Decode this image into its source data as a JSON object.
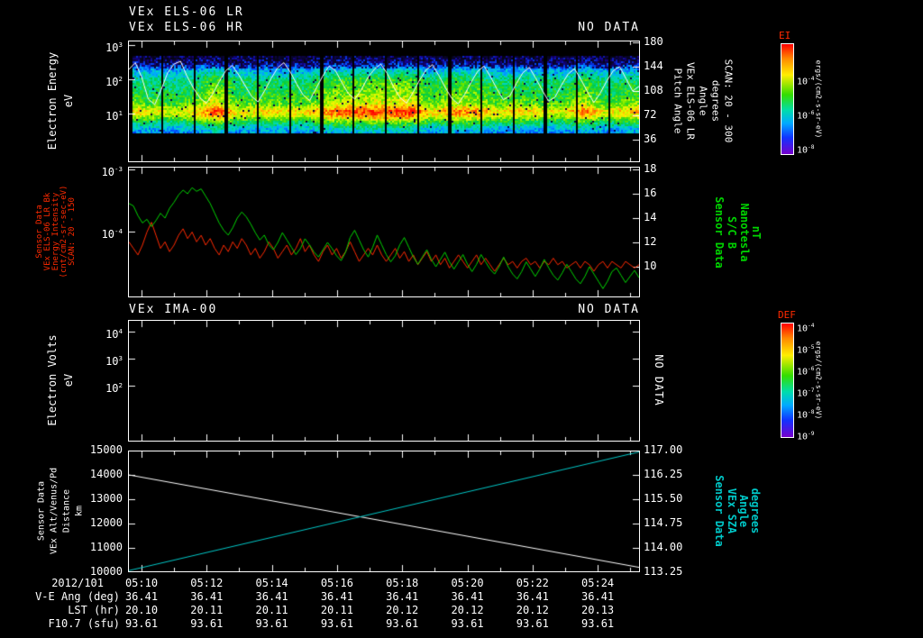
{
  "header": {
    "title_lr": "VEx ELS-06 LR",
    "title_hr": "VEx ELS-06 HR",
    "no_data": "NO DATA"
  },
  "accent_colors": {
    "white": "#ffffff",
    "red": "#ff2a00",
    "green": "#00d400",
    "cyan": "#00c8c8"
  },
  "chart_data": [
    {
      "type": "heatmap",
      "name": "els_spectrogram",
      "title": "VEx ELS-06 HR",
      "left_labels": [
        "Electron Energy",
        "eV"
      ],
      "yticks": [
        {
          "b": "10",
          "e": "3"
        },
        {
          "b": "10",
          "e": "2"
        },
        {
          "b": "10",
          "e": "1"
        }
      ],
      "right_labels": [
        "Pitch Angle",
        "VEx ELS-06 LR",
        "Angle",
        "degrees",
        "SCAN: 20 - 300"
      ],
      "right_ticks": [
        "180",
        "144",
        "108",
        "72",
        "36"
      ],
      "colorscale": "rainbow",
      "pitch_trace": [
        140,
        150,
        128,
        96,
        88,
        110,
        135,
        148,
        152,
        130,
        112,
        98,
        90,
        104,
        122,
        138,
        146,
        132,
        116,
        100,
        92,
        108,
        126,
        142,
        150,
        136,
        118,
        102,
        94,
        112,
        130,
        145,
        138,
        120,
        104,
        96,
        110,
        128,
        140,
        148,
        134,
        114,
        98,
        90,
        106,
        124,
        139,
        147,
        131,
        113,
        97,
        89,
        103,
        121,
        137,
        145,
        129,
        111,
        95,
        101,
        119,
        135,
        143,
        127,
        109,
        93,
        99,
        117,
        133,
        141,
        125,
        107,
        91,
        105,
        123,
        138,
        144,
        126,
        108,
        115
      ]
    },
    {
      "type": "line",
      "name": "intensity_and_bfield",
      "left_labels": [
        "Sensor Data",
        "VEx ELS-06 LR Bk",
        "Energy Intensity",
        "(cnt/cm2-sr-sec-eV)",
        "SCAN: 20 - 150"
      ],
      "left_ticks": [
        {
          "b": "10",
          "e": "-3"
        },
        {
          "b": "10",
          "e": "-4"
        }
      ],
      "left_range_log10": [
        -5,
        -3
      ],
      "right_labels": [
        "Sensor Data",
        "S/C B",
        "Nanotesla",
        "nT"
      ],
      "right_ticks": [
        "18",
        "16",
        "14",
        "12",
        "10"
      ],
      "right_range_nT": [
        7.5,
        18.2
      ],
      "series": [
        {
          "name": "els_bk_intensity_log10",
          "color": "#ff2a00",
          "axis": "left",
          "values": [
            -4.15,
            -4.25,
            -4.35,
            -4.2,
            -4.0,
            -3.85,
            -4.05,
            -4.25,
            -4.15,
            -4.3,
            -4.2,
            -4.05,
            -3.95,
            -4.1,
            -4.0,
            -4.15,
            -4.05,
            -4.2,
            -4.1,
            -4.25,
            -4.35,
            -4.2,
            -4.3,
            -4.15,
            -4.25,
            -4.1,
            -4.2,
            -4.35,
            -4.25,
            -4.4,
            -4.3,
            -4.15,
            -4.25,
            -4.4,
            -4.3,
            -4.2,
            -4.35,
            -4.25,
            -4.1,
            -4.3,
            -4.2,
            -4.35,
            -4.45,
            -4.3,
            -4.2,
            -4.35,
            -4.25,
            -4.4,
            -4.3,
            -4.15,
            -4.3,
            -4.45,
            -4.35,
            -4.25,
            -4.35,
            -4.2,
            -4.35,
            -4.45,
            -4.35,
            -4.25,
            -4.4,
            -4.3,
            -4.45,
            -4.35,
            -4.5,
            -4.4,
            -4.3,
            -4.45,
            -4.35,
            -4.5,
            -4.4,
            -4.55,
            -4.45,
            -4.35,
            -4.45,
            -4.55,
            -4.45,
            -4.35,
            -4.5,
            -4.4,
            -4.5,
            -4.6,
            -4.5,
            -4.4,
            -4.5,
            -4.45,
            -4.55,
            -4.45,
            -4.4,
            -4.5,
            -4.45,
            -4.55,
            -4.45,
            -4.5,
            -4.4,
            -4.5,
            -4.45,
            -4.55,
            -4.5,
            -4.45,
            -4.55,
            -4.45,
            -4.5,
            -4.6,
            -4.5,
            -4.45,
            -4.55,
            -4.45,
            -4.5,
            -4.55,
            -4.45,
            -4.5,
            -4.55,
            -4.5
          ]
        },
        {
          "name": "sc_b_field_nT",
          "color": "#00d400",
          "axis": "right",
          "values": [
            15.2,
            15.0,
            14.2,
            13.6,
            13.9,
            13.3,
            13.8,
            14.4,
            14.0,
            14.8,
            15.3,
            15.9,
            16.3,
            16.0,
            16.5,
            16.2,
            16.4,
            15.8,
            15.2,
            14.4,
            13.6,
            13.0,
            12.6,
            13.2,
            14.0,
            14.5,
            14.1,
            13.5,
            12.8,
            12.2,
            12.6,
            11.8,
            11.4,
            12.0,
            12.8,
            12.2,
            11.6,
            11.0,
            11.5,
            12.3,
            11.8,
            11.2,
            10.8,
            11.4,
            12.0,
            11.5,
            10.9,
            10.5,
            11.2,
            12.4,
            13.0,
            12.2,
            11.4,
            10.8,
            11.6,
            12.6,
            11.8,
            11.0,
            10.4,
            10.9,
            11.8,
            12.4,
            11.6,
            10.8,
            10.2,
            10.8,
            11.4,
            10.6,
            10.0,
            10.6,
            11.2,
            10.4,
            9.8,
            10.4,
            11.0,
            10.2,
            9.6,
            10.2,
            11.0,
            10.4,
            9.8,
            9.4,
            10.0,
            10.8,
            10.0,
            9.4,
            9.0,
            9.6,
            10.4,
            9.8,
            9.2,
            9.8,
            10.6,
            9.9,
            9.3,
            8.9,
            9.5,
            10.2,
            9.6,
            9.0,
            8.6,
            9.2,
            10.0,
            9.4,
            8.8,
            8.2,
            8.8,
            9.6,
            9.9,
            9.3,
            8.7,
            9.2,
            9.7,
            9.1
          ]
        }
      ]
    },
    {
      "type": "empty",
      "name": "ima_panel",
      "title": "VEx IMA-00",
      "no_data": "NO DATA",
      "right_note": "NO DATA",
      "left_labels": [
        "Electron Volts",
        "eV"
      ],
      "yticks": [
        {
          "b": "10",
          "e": "4"
        },
        {
          "b": "10",
          "e": "3"
        },
        {
          "b": "10",
          "e": "2"
        }
      ]
    },
    {
      "type": "line",
      "name": "altitude_and_sza",
      "left_labels": [
        "Sensor Data",
        "VEx Alt/Venus/Pd",
        "Distance",
        "km"
      ],
      "left_ticks": [
        "15000",
        "14000",
        "13000",
        "12000",
        "11000",
        "10000"
      ],
      "left_range_km": [
        10000,
        15000
      ],
      "right_labels": [
        "Sensor Data",
        "VEx SZA",
        "Angle",
        "degrees"
      ],
      "right_ticks": [
        "117.00",
        "116.25",
        "115.50",
        "114.75",
        "114.00",
        "113.25"
      ],
      "right_range_deg": [
        113.25,
        117.0
      ],
      "series": [
        {
          "name": "altitude_km",
          "color": "#ffffff",
          "axis": "left",
          "values": [
            14000,
            10200
          ]
        },
        {
          "name": "sza_deg",
          "color": "#00c8c8",
          "axis": "right",
          "values": [
            113.3,
            117.0
          ]
        }
      ]
    }
  ],
  "colorbars": [
    {
      "label": "EI",
      "unit": "ergs/(cm2-s-sr-eV)",
      "ticks": [
        {
          "b": "10",
          "e": "-4"
        },
        {
          "b": "10",
          "e": "-6"
        },
        {
          "b": "10",
          "e": "-8"
        }
      ]
    },
    {
      "label": "DEF",
      "unit": "ergs/(cm2-s-sr-eV)",
      "ticks": [
        {
          "b": "10",
          "e": "-4"
        },
        {
          "b": "10",
          "e": "-5"
        },
        {
          "b": "10",
          "e": "-6"
        },
        {
          "b": "10",
          "e": "-7"
        },
        {
          "b": "10",
          "e": "-8"
        },
        {
          "b": "10",
          "e": "-9"
        }
      ]
    }
  ],
  "bottom_axis": {
    "date": "2012/101",
    "times": [
      "05:10",
      "05:12",
      "05:14",
      "05:16",
      "05:18",
      "05:20",
      "05:22",
      "05:24"
    ],
    "rows": [
      {
        "label": "V-E Ang (deg)",
        "values": [
          "36.41",
          "36.41",
          "36.41",
          "36.41",
          "36.41",
          "36.41",
          "36.41",
          "36.41"
        ]
      },
      {
        "label": "LST (hr)",
        "values": [
          "20.10",
          "20.11",
          "20.11",
          "20.11",
          "20.12",
          "20.12",
          "20.12",
          "20.13"
        ]
      },
      {
        "label": "F10.7 (sfu)",
        "values": [
          "93.61",
          "93.61",
          "93.61",
          "93.61",
          "93.61",
          "93.61",
          "93.61",
          "93.61"
        ]
      }
    ]
  }
}
